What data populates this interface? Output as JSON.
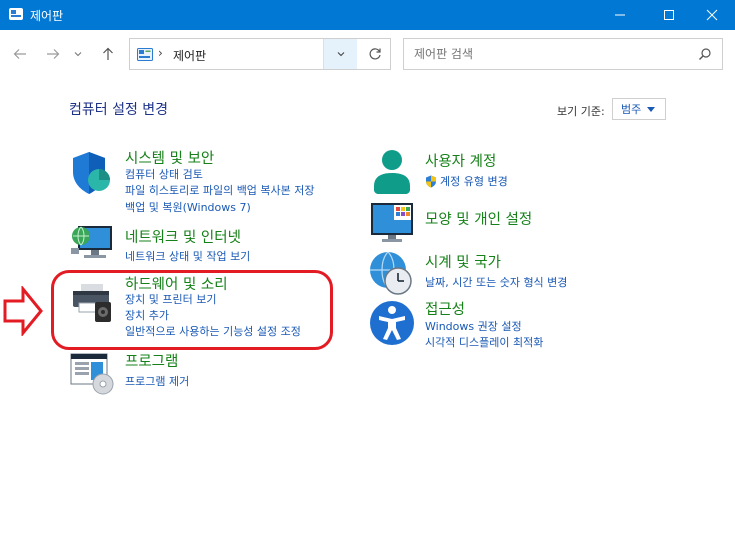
{
  "window": {
    "title": "제어판"
  },
  "address": {
    "separator": "›",
    "path": "제어판"
  },
  "search": {
    "placeholder": "제어판 검색"
  },
  "main": {
    "title": "컴퓨터 설정 변경",
    "view_by_label": "보기 기준:",
    "view_by_value": "범주"
  },
  "categories": {
    "system": {
      "title": "시스템 및 보안",
      "links": [
        "컴퓨터 상태 검토",
        "파일 히스토리로 파일의 백업 복사본 저장",
        "백업 및 복원(Windows 7)"
      ]
    },
    "network": {
      "title": "네트워크 및 인터넷",
      "links": [
        "네트워크 상태 및 작업 보기"
      ]
    },
    "hardware": {
      "title": "하드웨어 및 소리",
      "links": [
        "장치 및 프린터 보기",
        "장치 추가",
        "일반적으로 사용하는 기능성 설정 조정"
      ]
    },
    "programs": {
      "title": "프로그램",
      "links": [
        "프로그램 제거"
      ]
    },
    "users": {
      "title": "사용자 계정",
      "links": [
        "계정 유형 변경"
      ]
    },
    "appearance": {
      "title": "모양 및 개인 설정",
      "links": []
    },
    "clock": {
      "title": "시계 및 국가",
      "links": [
        "날짜, 시간 또는 숫자 형식 변경"
      ]
    },
    "ease": {
      "title": "접근성",
      "links": [
        "Windows 권장 설정",
        "시각적 디스플레이 최적화"
      ]
    }
  },
  "colors": {
    "titlebar": "#0078d4",
    "category_title": "#168118",
    "link": "#1a59b5",
    "annotation": "#e31b23"
  }
}
